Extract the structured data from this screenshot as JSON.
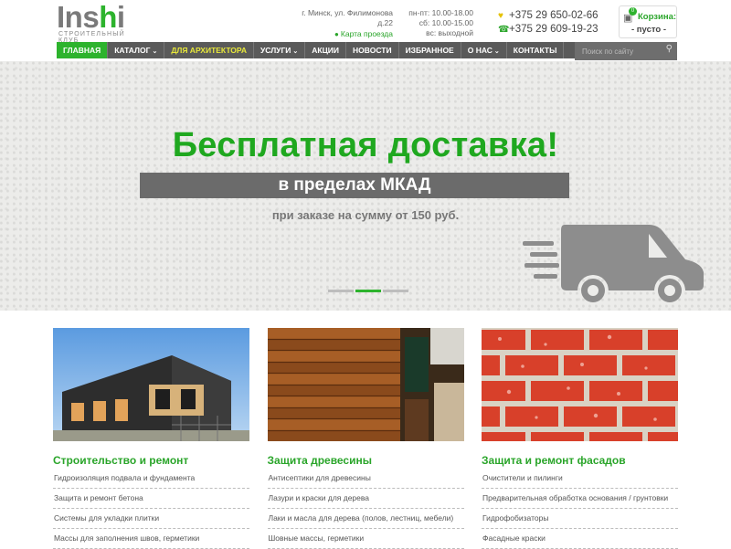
{
  "brand": {
    "logo_main": "Insi",
    "logo_dot": "i",
    "logo_sub": "Строительный клуб"
  },
  "contacts": {
    "address_line1": "г. Минск, ул. Филимонова",
    "address_line2": "д.22",
    "map_link": "Карта проезда",
    "hours": [
      "пн-пт: 10.00-18.00",
      "сб: 10.00-15.00",
      "вс: выходной"
    ],
    "phone1": "+375 29 650-02-66",
    "phone2": "+375 29 609-19-23"
  },
  "cart": {
    "title": "Корзина:",
    "status": "- пусто -",
    "count": "0"
  },
  "nav": {
    "items": [
      {
        "label": "ГЛАВНАЯ"
      },
      {
        "label": "КАТАЛОГ"
      },
      {
        "label": "ДЛЯ АРХИТЕКТОРА"
      },
      {
        "label": "УСЛУГИ"
      },
      {
        "label": "АКЦИИ"
      },
      {
        "label": "НОВОСТИ"
      },
      {
        "label": "ИЗБРАННОЕ"
      },
      {
        "label": "О НАС"
      },
      {
        "label": "КОНТАКТЫ"
      }
    ],
    "search_placeholder": "Поиск по сайту"
  },
  "banner": {
    "title": "Бесплатная доставка!",
    "strip": "в пределах МКАД",
    "note": "при заказе на сумму от 150 руб."
  },
  "cards": [
    {
      "title": "Строительство и ремонт",
      "items": [
        "Гидроизоляция подвала и фундамента",
        "Защита и ремонт бетона",
        "Системы для укладки плитки",
        "Массы для заполнения швов, герметики"
      ]
    },
    {
      "title": "Защита древесины",
      "items": [
        "Антисептики для древесины",
        "Лазури и краски для дерева",
        "Лаки и масла для дерева (полов, лестниц, мебели)",
        "Шовные массы, герметики"
      ]
    },
    {
      "title": "Защита и ремонт фасадов",
      "items": [
        "Очистители и пилинги",
        "Предварительная обработка основания / грунтовки",
        "Гидрофобизаторы",
        "Фасадные краски"
      ]
    }
  ],
  "colors": {
    "accent": "#2db32d",
    "nav_bg": "#5a5a5a",
    "arch_link": "#e8e83a"
  }
}
